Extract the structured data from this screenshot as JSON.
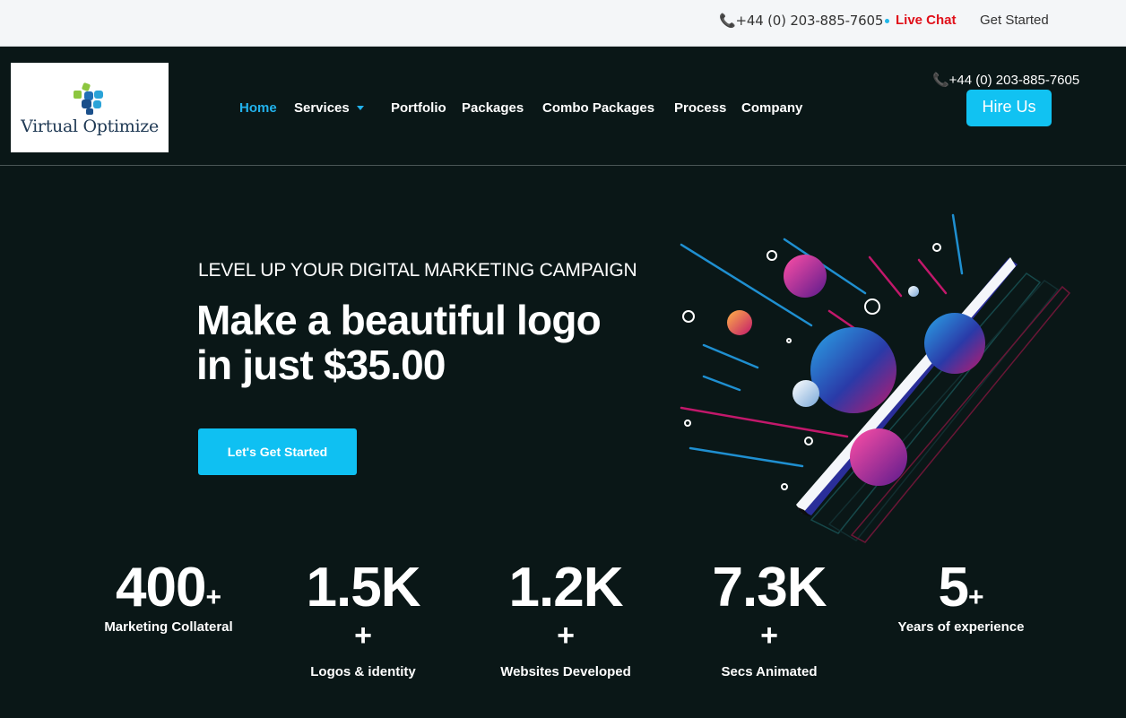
{
  "topbar": {
    "phone": "📞+44 (0) 203-885-7605",
    "live_chat": "Live Chat",
    "get_started": "Get Started"
  },
  "header": {
    "logo_text": "Virtual Optimize",
    "phone": "📞+44 (0) 203-885-7605",
    "hire_label": "Hire Us",
    "nav": [
      {
        "label": "Home"
      },
      {
        "label": "Services"
      },
      {
        "label": "Portfolio"
      },
      {
        "label": "Packages"
      },
      {
        "label": "Combo Packages"
      },
      {
        "label": "Process"
      },
      {
        "label": "Company"
      }
    ]
  },
  "hero": {
    "eyebrow": "LEVEL UP YOUR DIGITAL MARKETING CAMPAIGN",
    "headline_line1": "Make a beautiful logo",
    "headline_line2": "in just $35.00",
    "cta_label": "Let's Get Started"
  },
  "stats": [
    {
      "value": "400",
      "plus": "+",
      "label": "Marketing Collateral"
    },
    {
      "value": "1.5K",
      "plus": "+",
      "label": "Logos & identity"
    },
    {
      "value": "1.2K",
      "plus": "+",
      "label": "Websites Developed"
    },
    {
      "value": "7.3K",
      "plus": "+",
      "label": "Secs Animated"
    },
    {
      "value": "5",
      "plus": "+",
      "label": "Years of experience"
    }
  ],
  "colors": {
    "accent": "#11c2f2",
    "active_nav": "#22b2ec",
    "live_chat": "#e0101a",
    "background": "#0a1717"
  },
  "icons": [
    "phone-icon",
    "chevron-down-icon",
    "logo-mark-icon"
  ]
}
